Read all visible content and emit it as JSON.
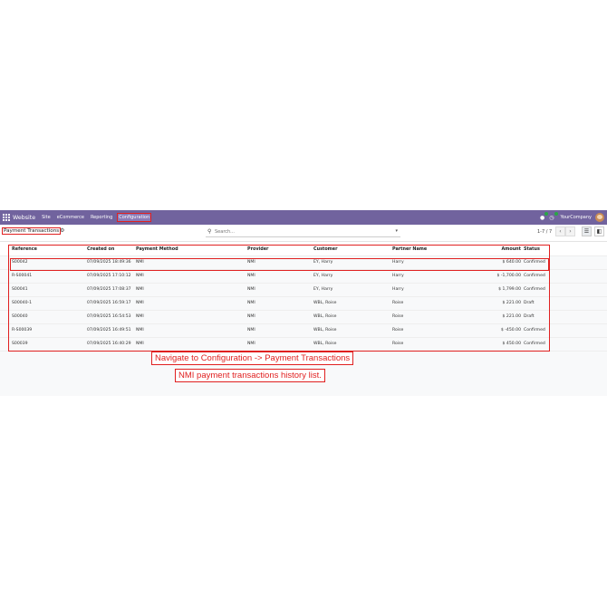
{
  "navbar": {
    "brand": "Website",
    "menu": [
      "Site",
      "eCommerce",
      "Reporting",
      "Configuration"
    ],
    "company": "YourCompany"
  },
  "control": {
    "title": "Payment Transactions",
    "search_placeholder": "Search...",
    "pager": "1-7 / 7"
  },
  "table": {
    "columns": [
      "Reference",
      "Created on",
      "Payment Method",
      "Provider",
      "Customer",
      "Partner Name",
      "Amount",
      "Status"
    ],
    "rows": [
      {
        "reference": "S00042",
        "created": "07/09/2025 18:49:36",
        "method": "NMI",
        "provider": "NMI",
        "customer": "EY, Harry",
        "partner": "Harry",
        "amount": "$ 640.00",
        "status": "Confirmed"
      },
      {
        "reference": "R-S00041",
        "created": "07/09/2025 17:10:12",
        "method": "NMI",
        "provider": "NMI",
        "customer": "EY, Harry",
        "partner": "Harry",
        "amount": "$ -1,700.00",
        "status": "Confirmed"
      },
      {
        "reference": "S00041",
        "created": "07/09/2025 17:08:37",
        "method": "NMI",
        "provider": "NMI",
        "customer": "EY, Harry",
        "partner": "Harry",
        "amount": "$ 1,799.00",
        "status": "Confirmed"
      },
      {
        "reference": "S00040-1",
        "created": "07/09/2025 16:59:17",
        "method": "NMI",
        "provider": "NMI",
        "customer": "WBL, Roise",
        "partner": "Roise",
        "amount": "$ 221.00",
        "status": "Draft"
      },
      {
        "reference": "S00040",
        "created": "07/09/2025 16:54:53",
        "method": "NMI",
        "provider": "NMI",
        "customer": "WBL, Roise",
        "partner": "Roise",
        "amount": "$ 221.00",
        "status": "Draft"
      },
      {
        "reference": "R-S00039",
        "created": "07/09/2025 16:49:51",
        "method": "NMI",
        "provider": "NMI",
        "customer": "WBL, Roise",
        "partner": "Roise",
        "amount": "$ -450.00",
        "status": "Confirmed"
      },
      {
        "reference": "S00039",
        "created": "07/09/2025 16:40:29",
        "method": "NMI",
        "provider": "NMI",
        "customer": "WBL, Roise",
        "partner": "Roise",
        "amount": "$ 450.00",
        "status": "Confirmed"
      }
    ]
  },
  "annotations": {
    "nav_hint": "Navigate to Configuration -> Payment Transactions",
    "list_hint": "NMI payment transactions history list."
  }
}
